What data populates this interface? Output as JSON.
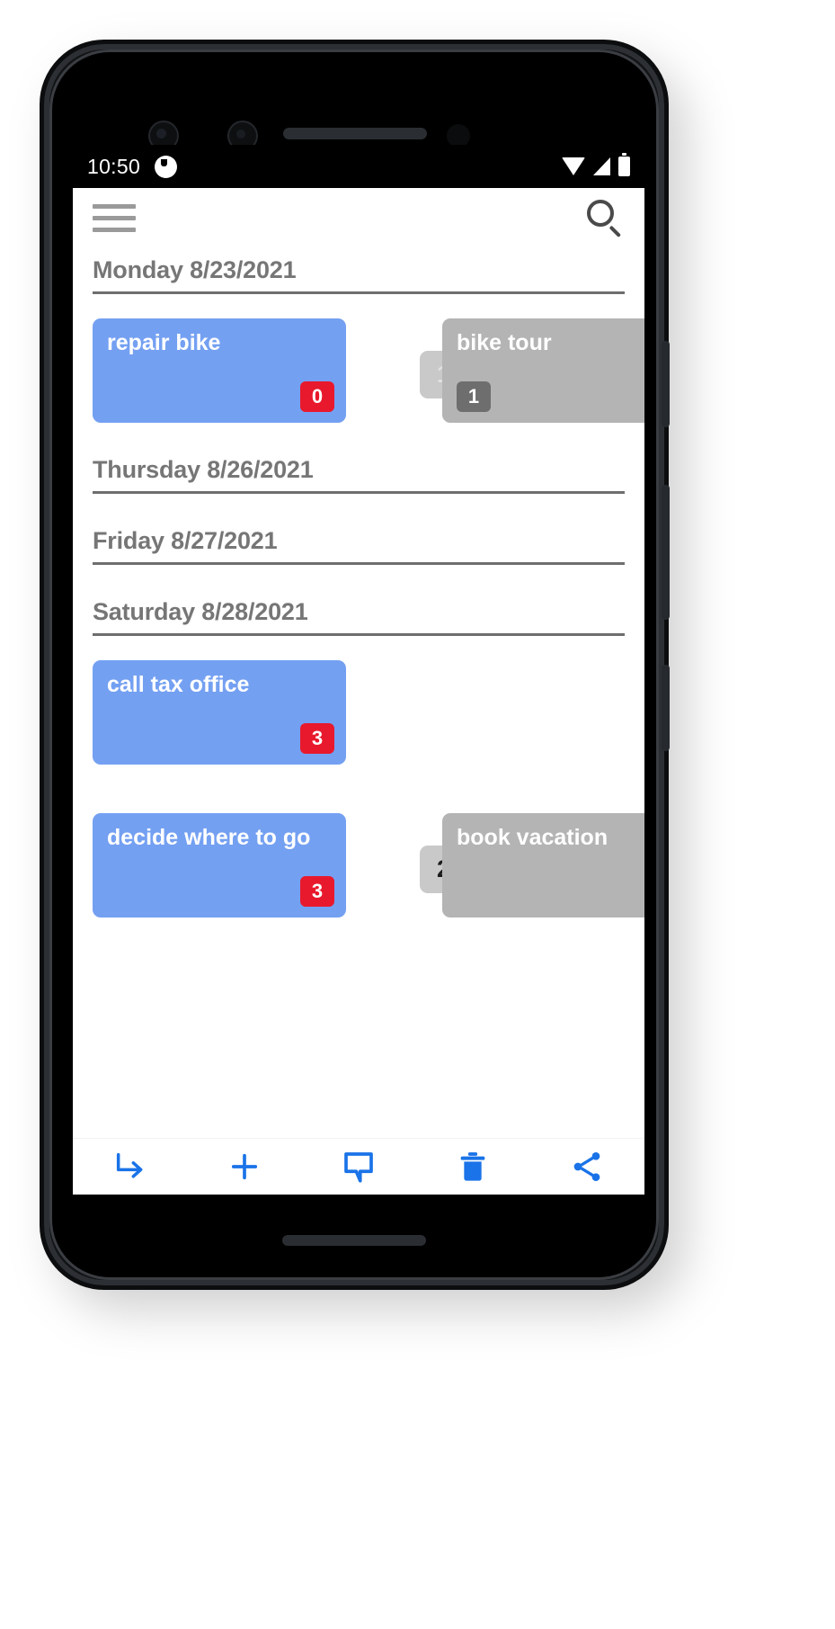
{
  "status_bar": {
    "time": "10:50",
    "app_icon": "clock-app-icon",
    "icons": [
      "wifi-icon",
      "signal-icon",
      "battery-icon"
    ]
  },
  "app_bar": {
    "menu_icon": "hamburger-menu-icon",
    "search_icon": "search-icon"
  },
  "colors": {
    "primary_card": "#74a0f2",
    "secondary_card": "#b4b4b4",
    "badge_red": "#e8192c",
    "badge_gray": "#6e6e6e",
    "chip_gray": "#c9c9c9",
    "toolbar_icon": "#1a73e8",
    "header_text": "#767676"
  },
  "sections": [
    {
      "date_label": "Monday 8/23/2021",
      "rows": [
        {
          "primary": {
            "title": "repair bike",
            "badge": "0",
            "badge_style": "red"
          },
          "chip": "1",
          "chip_style": "light",
          "secondary": {
            "title": "bike tour",
            "badge": "1",
            "badge_style": "gray"
          }
        }
      ]
    },
    {
      "date_label": "Thursday 8/26/2021",
      "rows": []
    },
    {
      "date_label": "Friday 8/27/2021",
      "rows": []
    },
    {
      "date_label": "Saturday 8/28/2021",
      "rows": [
        {
          "primary": {
            "title": "call tax office",
            "badge": "3",
            "badge_style": "red"
          },
          "chip": null,
          "secondary": null
        },
        {
          "primary": {
            "title": "decide where to go",
            "badge": "3",
            "badge_style": "red"
          },
          "chip": "2",
          "chip_style": "dark",
          "secondary": {
            "title": "book vacation",
            "badge": null,
            "badge_style": "gray"
          }
        }
      ]
    }
  ],
  "bottom_toolbar": {
    "buttons": [
      {
        "name": "indent-arrow-icon",
        "label": "Indent"
      },
      {
        "name": "plus-icon",
        "label": "Add"
      },
      {
        "name": "comment-icon",
        "label": "Comment"
      },
      {
        "name": "trash-icon",
        "label": "Delete"
      },
      {
        "name": "share-icon",
        "label": "Share"
      }
    ]
  }
}
